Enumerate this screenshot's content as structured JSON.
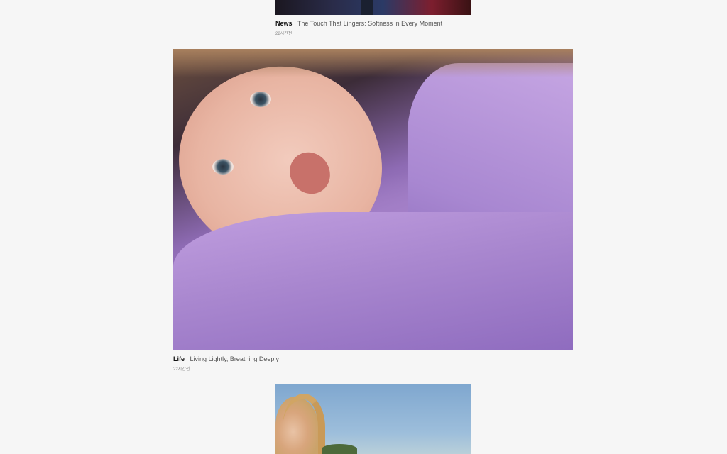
{
  "posts": [
    {
      "category": "News",
      "title": "The Touch That Lingers: Softness in Every Moment",
      "time": "22시간전"
    },
    {
      "category": "Life",
      "title": "Living Lightly, Breathing Deeply",
      "time": "22시간전"
    },
    {
      "category": "",
      "title": "",
      "time": ""
    }
  ]
}
